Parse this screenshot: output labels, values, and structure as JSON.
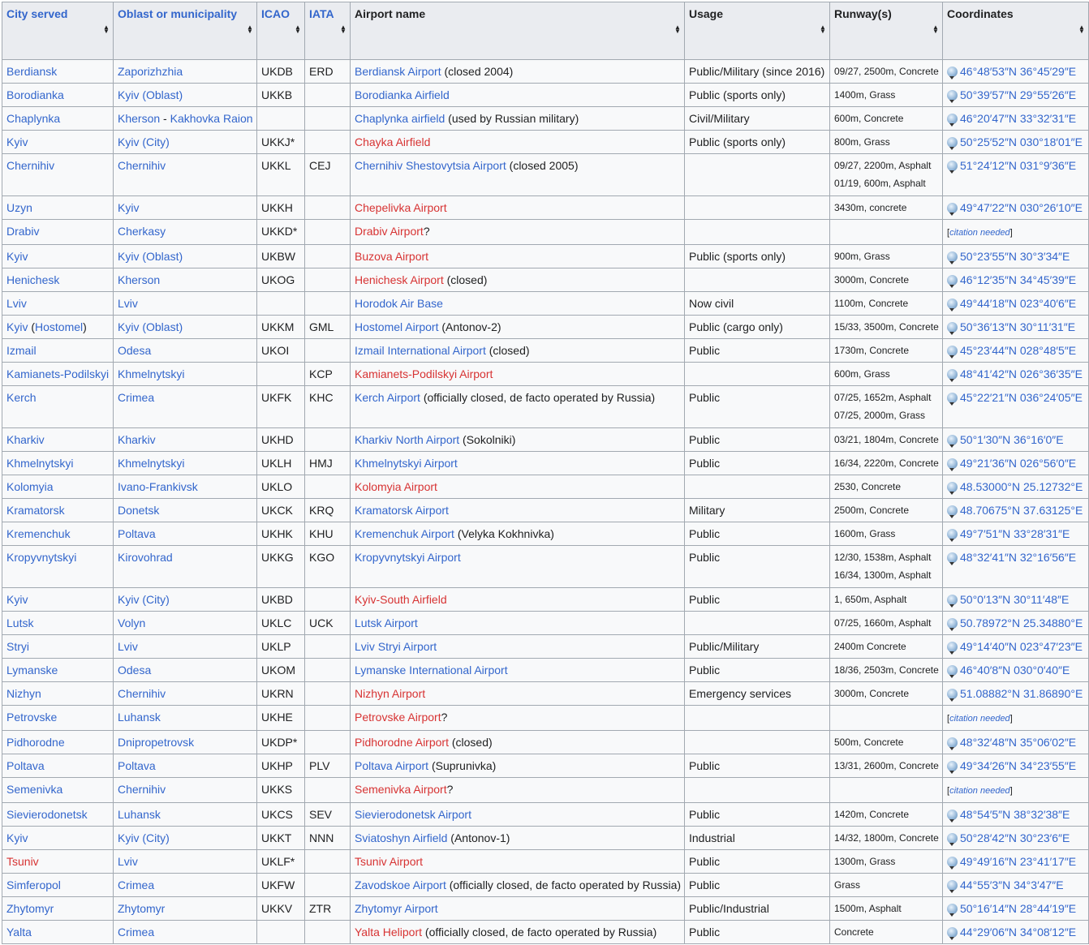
{
  "headers": [
    "City served",
    "Oblast or municipality",
    "ICAO",
    "IATA",
    "Airport name",
    "Usage",
    "Runway(s)",
    "Coordinates"
  ],
  "citation_text": "citation needed",
  "colors": {
    "link": "#3366cc",
    "redlink": "#d73333",
    "header_bg": "#eaecf0",
    "cell_bg": "#f8f9fa",
    "border": "#a2a9b1"
  },
  "rows": [
    {
      "city": [
        [
          "b",
          "Berdiansk"
        ]
      ],
      "oblast": [
        [
          "b",
          "Zaporizhzhia"
        ]
      ],
      "icao": "UKDB",
      "iata": "ERD",
      "airport": [
        [
          "b",
          "Berdiansk Airport"
        ],
        [
          "p",
          " (closed 2004)"
        ]
      ],
      "usage": "Public/Military (since 2016)",
      "runways": [
        "09/27, 2500m, Concrete"
      ],
      "coord": "46°48′53″N 36°45′29″E"
    },
    {
      "city": [
        [
          "b",
          "Borodianka"
        ]
      ],
      "oblast": [
        [
          "b",
          "Kyiv (Oblast)"
        ]
      ],
      "icao": "UKKB",
      "iata": "",
      "airport": [
        [
          "b",
          "Borodianka Airfield"
        ]
      ],
      "usage": "Public (sports only)",
      "runways": [
        "1400m, Grass"
      ],
      "coord": "50°39′57″N 29°55′26″E"
    },
    {
      "city": [
        [
          "b",
          "Chaplynka"
        ]
      ],
      "oblast": [
        [
          "b",
          "Kherson"
        ],
        [
          "p",
          " - "
        ],
        [
          "b",
          "Kakhovka Raion"
        ]
      ],
      "icao": "",
      "iata": "",
      "airport": [
        [
          "b",
          "Chaplynka airfield"
        ],
        [
          "p",
          " (used by Russian military)"
        ]
      ],
      "usage": "Civil/Military",
      "runways": [
        "600m, Concrete"
      ],
      "coord": "46°20′47″N 33°32′31″E"
    },
    {
      "city": [
        [
          "b",
          "Kyiv"
        ]
      ],
      "oblast": [
        [
          "b",
          "Kyiv (City)"
        ]
      ],
      "icao": "UKKJ*",
      "iata": "",
      "airport": [
        [
          "r",
          "Chayka Airfield"
        ]
      ],
      "usage": "Public (sports only)",
      "runways": [
        "800m, Grass"
      ],
      "coord": "50°25′52″N 030°18′01″E"
    },
    {
      "city": [
        [
          "b",
          "Chernihiv"
        ]
      ],
      "oblast": [
        [
          "b",
          "Chernihiv"
        ]
      ],
      "icao": "UKKL",
      "iata": "CEJ",
      "airport": [
        [
          "b",
          "Chernihiv Shestovytsia Airport"
        ],
        [
          "p",
          " (closed 2005)"
        ]
      ],
      "usage": "",
      "runways": [
        "09/27, 2200m, Asphalt",
        "01/19, 600m, Asphalt"
      ],
      "coord": "51°24′12″N 031°9′36″E"
    },
    {
      "city": [
        [
          "b",
          "Uzyn"
        ]
      ],
      "oblast": [
        [
          "b",
          "Kyiv"
        ]
      ],
      "icao": "UKKH",
      "iata": "",
      "airport": [
        [
          "r",
          "Chepelivka Airport"
        ]
      ],
      "usage": "",
      "runways": [
        "3430m, concrete"
      ],
      "coord": "49°47′22″N 030°26′10″E"
    },
    {
      "city": [
        [
          "b",
          "Drabiv"
        ]
      ],
      "oblast": [
        [
          "b",
          "Cherkasy"
        ]
      ],
      "icao": "UKKD*",
      "iata": "",
      "airport": [
        [
          "r",
          "Drabiv Airport"
        ],
        [
          "p",
          "?"
        ]
      ],
      "usage": "",
      "runways": [],
      "coord": null
    },
    {
      "city": [
        [
          "b",
          "Kyiv"
        ]
      ],
      "oblast": [
        [
          "b",
          "Kyiv (Oblast)"
        ]
      ],
      "icao": "UKBW",
      "iata": "",
      "airport": [
        [
          "r",
          "Buzova Airport"
        ]
      ],
      "usage": "Public (sports only)",
      "runways": [
        "900m, Grass"
      ],
      "coord": "50°23′55″N 30°3′34″E"
    },
    {
      "city": [
        [
          "b",
          "Henichesk"
        ]
      ],
      "oblast": [
        [
          "b",
          "Kherson"
        ]
      ],
      "icao": "UKOG",
      "iata": "",
      "airport": [
        [
          "r",
          "Henichesk Airport"
        ],
        [
          "p",
          " (closed)"
        ]
      ],
      "usage": "",
      "runways": [
        "3000m, Concrete"
      ],
      "coord": "46°12′35″N 34°45′39″E"
    },
    {
      "city": [
        [
          "b",
          "Lviv"
        ]
      ],
      "oblast": [
        [
          "b",
          "Lviv"
        ]
      ],
      "icao": "",
      "iata": "",
      "airport": [
        [
          "b",
          "Horodok Air Base"
        ]
      ],
      "usage": "Now civil",
      "runways": [
        "1100m, Concrete"
      ],
      "coord": "49°44′18″N 023°40′6″E"
    },
    {
      "city": [
        [
          "b",
          "Kyiv"
        ],
        [
          "p",
          " ("
        ],
        [
          "b",
          "Hostomel"
        ],
        [
          "p",
          ")"
        ]
      ],
      "oblast": [
        [
          "b",
          "Kyiv (Oblast)"
        ]
      ],
      "icao": "UKKM",
      "iata": "GML",
      "airport": [
        [
          "b",
          "Hostomel Airport"
        ],
        [
          "p",
          " (Antonov-2)"
        ]
      ],
      "usage": "Public (cargo only)",
      "runways": [
        "15/33, 3500m, Concrete"
      ],
      "coord": "50°36′13″N 30°11′31″E"
    },
    {
      "city": [
        [
          "b",
          "Izmail"
        ]
      ],
      "oblast": [
        [
          "b",
          "Odesa"
        ]
      ],
      "icao": "UKOI",
      "iata": "",
      "airport": [
        [
          "b",
          "Izmail International Airport"
        ],
        [
          "p",
          " (closed)"
        ]
      ],
      "usage": "Public",
      "runways": [
        "1730m, Concrete"
      ],
      "coord": "45°23′44″N 028°48′5″E"
    },
    {
      "city": [
        [
          "b",
          "Kamianets-Podilskyi"
        ]
      ],
      "oblast": [
        [
          "b",
          "Khmelnytskyi"
        ]
      ],
      "icao": "",
      "iata": "KCP",
      "airport": [
        [
          "r",
          "Kamianets-Podilskyi Airport"
        ]
      ],
      "usage": "",
      "runways": [
        "600m, Grass"
      ],
      "coord": "48°41′42″N 026°36′35″E"
    },
    {
      "city": [
        [
          "b",
          "Kerch"
        ]
      ],
      "oblast": [
        [
          "b",
          "Crimea"
        ]
      ],
      "icao": "UKFK",
      "iata": "KHC",
      "airport": [
        [
          "b",
          "Kerch Airport"
        ],
        [
          "p",
          " (officially closed, de facto operated by Russia)"
        ]
      ],
      "usage": "Public",
      "runways": [
        "07/25, 1652m, Asphalt",
        "07/25, 2000m, Grass"
      ],
      "coord": "45°22′21″N 036°24′05″E"
    },
    {
      "city": [
        [
          "b",
          "Kharkiv"
        ]
      ],
      "oblast": [
        [
          "b",
          "Kharkiv"
        ]
      ],
      "icao": "UKHD",
      "iata": "",
      "airport": [
        [
          "b",
          "Kharkiv North Airport"
        ],
        [
          "p",
          " (Sokolniki)"
        ]
      ],
      "usage": "Public",
      "runways": [
        "03/21, 1804m, Concrete"
      ],
      "coord": "50°1′30″N 36°16′0″E"
    },
    {
      "city": [
        [
          "b",
          "Khmelnytskyi"
        ]
      ],
      "oblast": [
        [
          "b",
          "Khmelnytskyi"
        ]
      ],
      "icao": "UKLH",
      "iata": "HMJ",
      "airport": [
        [
          "b",
          "Khmelnytskyi Airport"
        ]
      ],
      "usage": "Public",
      "runways": [
        "16/34, 2220m, Concrete"
      ],
      "coord": "49°21′36″N 026°56′0″E"
    },
    {
      "city": [
        [
          "b",
          "Kolomyia"
        ]
      ],
      "oblast": [
        [
          "b",
          "Ivano-Frankivsk"
        ]
      ],
      "icao": "UKLO",
      "iata": "",
      "airport": [
        [
          "r",
          "Kolomyia Airport"
        ]
      ],
      "usage": "",
      "runways": [
        "2530, Concrete"
      ],
      "coord": "48.53000°N 25.12732°E"
    },
    {
      "city": [
        [
          "b",
          "Kramatorsk"
        ]
      ],
      "oblast": [
        [
          "b",
          "Donetsk"
        ]
      ],
      "icao": "UKCK",
      "iata": "KRQ",
      "airport": [
        [
          "b",
          "Kramatorsk Airport"
        ]
      ],
      "usage": "Military",
      "runways": [
        "2500m, Concrete"
      ],
      "coord": "48.70675°N 37.63125°E"
    },
    {
      "city": [
        [
          "b",
          "Kremenchuk"
        ]
      ],
      "oblast": [
        [
          "b",
          "Poltava"
        ]
      ],
      "icao": "UKHK",
      "iata": "KHU",
      "airport": [
        [
          "b",
          "Kremenchuk Airport"
        ],
        [
          "p",
          " (Velyka Kokhnivka)"
        ]
      ],
      "usage": "Public",
      "runways": [
        "1600m, Grass"
      ],
      "coord": "49°7′51″N 33°28′31″E"
    },
    {
      "city": [
        [
          "b",
          "Kropyvnytskyi"
        ]
      ],
      "oblast": [
        [
          "b",
          "Kirovohrad"
        ]
      ],
      "icao": "UKKG",
      "iata": "KGO",
      "airport": [
        [
          "b",
          "Kropyvnytskyi Airport"
        ]
      ],
      "usage": "Public",
      "runways": [
        "12/30, 1538m, Asphalt",
        "16/34, 1300m, Asphalt"
      ],
      "coord": "48°32′41″N 32°16′56″E"
    },
    {
      "city": [
        [
          "b",
          "Kyiv"
        ]
      ],
      "oblast": [
        [
          "b",
          "Kyiv (City)"
        ]
      ],
      "icao": "UKBD",
      "iata": "",
      "airport": [
        [
          "r",
          "Kyiv-South Airfield"
        ]
      ],
      "usage": "Public",
      "runways": [
        "1, 650m, Asphalt"
      ],
      "coord": "50°0′13″N 30°11′48″E"
    },
    {
      "city": [
        [
          "b",
          "Lutsk"
        ]
      ],
      "oblast": [
        [
          "b",
          "Volyn"
        ]
      ],
      "icao": "UKLC",
      "iata": "UCK",
      "airport": [
        [
          "b",
          "Lutsk Airport"
        ]
      ],
      "usage": "",
      "runways": [
        "07/25, 1660m, Asphalt"
      ],
      "coord": "50.78972°N 25.34880°E"
    },
    {
      "city": [
        [
          "b",
          "Stryi"
        ]
      ],
      "oblast": [
        [
          "b",
          "Lviv"
        ]
      ],
      "icao": "UKLP",
      "iata": "",
      "airport": [
        [
          "b",
          "Lviv Stryi Airport"
        ]
      ],
      "usage": "Public/Military",
      "runways": [
        "2400m Concrete"
      ],
      "coord": "49°14′40″N 023°47′23″E"
    },
    {
      "city": [
        [
          "b",
          "Lymanske"
        ]
      ],
      "oblast": [
        [
          "b",
          "Odesa"
        ]
      ],
      "icao": "UKOM",
      "iata": "",
      "airport": [
        [
          "b",
          "Lymanske International Airport"
        ]
      ],
      "usage": "Public",
      "runways": [
        "18/36, 2503m, Concrete"
      ],
      "coord": "46°40′8″N 030°0′40″E"
    },
    {
      "city": [
        [
          "b",
          "Nizhyn"
        ]
      ],
      "oblast": [
        [
          "b",
          "Chernihiv"
        ]
      ],
      "icao": "UKRN",
      "iata": "",
      "airport": [
        [
          "r",
          "Nizhyn Airport"
        ]
      ],
      "usage": "Emergency services",
      "runways": [
        "3000m, Concrete"
      ],
      "coord": "51.08882°N 31.86890°E"
    },
    {
      "city": [
        [
          "b",
          "Petrovske"
        ]
      ],
      "oblast": [
        [
          "b",
          "Luhansk"
        ]
      ],
      "icao": "UKHE",
      "iata": "",
      "airport": [
        [
          "r",
          "Petrovske Airport"
        ],
        [
          "p",
          "?"
        ]
      ],
      "usage": "",
      "runways": [],
      "coord": null
    },
    {
      "city": [
        [
          "b",
          "Pidhorodne"
        ]
      ],
      "oblast": [
        [
          "b",
          "Dnipropetrovsk"
        ]
      ],
      "icao": "UKDP*",
      "iata": "",
      "airport": [
        [
          "r",
          "Pidhorodne Airport"
        ],
        [
          "p",
          " (closed)"
        ]
      ],
      "usage": "",
      "runways": [
        "500m, Concrete"
      ],
      "coord": "48°32′48″N 35°06′02″E"
    },
    {
      "city": [
        [
          "b",
          "Poltava"
        ]
      ],
      "oblast": [
        [
          "b",
          "Poltava"
        ]
      ],
      "icao": "UKHP",
      "iata": "PLV",
      "airport": [
        [
          "b",
          "Poltava Airport"
        ],
        [
          "p",
          " (Suprunivka)"
        ]
      ],
      "usage": "Public",
      "runways": [
        "13/31, 2600m, Concrete"
      ],
      "coord": "49°34′26″N 34°23′55″E"
    },
    {
      "city": [
        [
          "b",
          "Semenivka"
        ]
      ],
      "oblast": [
        [
          "b",
          "Chernihiv"
        ]
      ],
      "icao": "UKKS",
      "iata": "",
      "airport": [
        [
          "r",
          "Semenivka Airport"
        ],
        [
          "p",
          "?"
        ]
      ],
      "usage": "",
      "runways": [],
      "coord": null
    },
    {
      "city": [
        [
          "b",
          "Sievierodonetsk"
        ]
      ],
      "oblast": [
        [
          "b",
          "Luhansk"
        ]
      ],
      "icao": "UKCS",
      "iata": "SEV",
      "airport": [
        [
          "b",
          "Sievierodonetsk Airport"
        ]
      ],
      "usage": "Public",
      "runways": [
        "1420m, Concrete"
      ],
      "coord": "48°54′5″N 38°32′38″E"
    },
    {
      "city": [
        [
          "b",
          "Kyiv"
        ]
      ],
      "oblast": [
        [
          "b",
          "Kyiv (City)"
        ]
      ],
      "icao": "UKKT",
      "iata": "NNN",
      "airport": [
        [
          "b",
          "Sviatoshyn Airfield"
        ],
        [
          "p",
          " (Antonov-1)"
        ]
      ],
      "usage": "Industrial",
      "runways": [
        "14/32, 1800m, Concrete"
      ],
      "coord": "50°28′42″N 30°23′6″E"
    },
    {
      "city": [
        [
          "r",
          "Tsuniv"
        ]
      ],
      "oblast": [
        [
          "b",
          "Lviv"
        ]
      ],
      "icao": "UKLF*",
      "iata": "",
      "airport": [
        [
          "r",
          "Tsuniv Airport"
        ]
      ],
      "usage": "Public",
      "runways": [
        "1300m, Grass"
      ],
      "coord": "49°49′16″N 23°41′17″E"
    },
    {
      "city": [
        [
          "b",
          "Simferopol"
        ]
      ],
      "oblast": [
        [
          "b",
          "Crimea"
        ]
      ],
      "icao": "UKFW",
      "iata": "",
      "airport": [
        [
          "b",
          "Zavodskoe Airport"
        ],
        [
          "p",
          " (officially closed, de facto operated by Russia)"
        ]
      ],
      "usage": "Public",
      "runways": [
        "Grass"
      ],
      "coord": "44°55′3″N 34°3′47″E"
    },
    {
      "city": [
        [
          "b",
          "Zhytomyr"
        ]
      ],
      "oblast": [
        [
          "b",
          "Zhytomyr"
        ]
      ],
      "icao": "UKKV",
      "iata": "ZTR",
      "airport": [
        [
          "b",
          "Zhytomyr Airport"
        ]
      ],
      "usage": "Public/Industrial",
      "runways": [
        "1500m, Asphalt"
      ],
      "coord": "50°16′14″N 28°44′19″E"
    },
    {
      "city": [
        [
          "b",
          "Yalta"
        ]
      ],
      "oblast": [
        [
          "b",
          "Crimea"
        ]
      ],
      "icao": "",
      "iata": "",
      "airport": [
        [
          "r",
          "Yalta Heliport"
        ],
        [
          "p",
          " (officially closed, de facto operated by Russia)"
        ]
      ],
      "usage": "Public",
      "runways": [
        "Concrete"
      ],
      "coord": "44°29′06″N 34°08′12″E"
    }
  ]
}
